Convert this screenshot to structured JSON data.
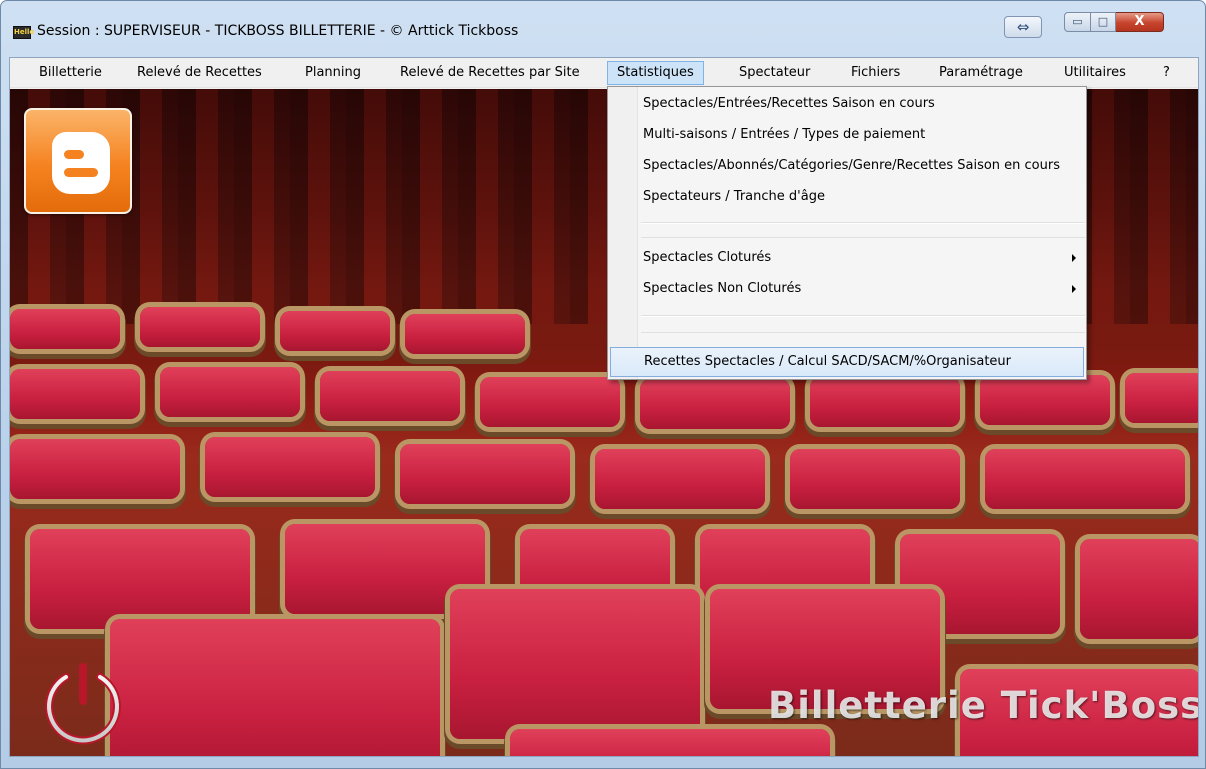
{
  "window": {
    "title": "Session : SUPERVISEUR - TICKBOSS BILLETTERIE -  © Arttick Tickboss",
    "app_icon_label": "Hello",
    "resize_glyph": "⇔",
    "minimize_glyph": "▭",
    "maximize_glyph": "□",
    "close_glyph": "X"
  },
  "menubar": {
    "items": [
      {
        "label": "Billetterie"
      },
      {
        "label": "Relevé de Recettes"
      },
      {
        "label": "Planning"
      },
      {
        "label": "Relevé de Recettes par Site"
      },
      {
        "label": "Statistiques",
        "active": true
      },
      {
        "label": "Spectateur"
      },
      {
        "label": "Fichiers"
      },
      {
        "label": "Paramétrage"
      },
      {
        "label": "Utilitaires"
      },
      {
        "label": "?"
      }
    ]
  },
  "dropdown": {
    "items": [
      {
        "label": "Spectacles/Entrées/Recettes Saison en cours"
      },
      {
        "label": "Multi-saisons / Entrées / Types de paiement"
      },
      {
        "label": "Spectacles/Abonnés/Catégories/Genre/Recettes Saison en cours"
      },
      {
        "label": "Spectateurs / Tranche d'âge"
      },
      {
        "label": "Spectacles Cloturés",
        "submenu": true
      },
      {
        "label": "Spectacles Non Cloturés",
        "submenu": true
      },
      {
        "label": "Recettes Spectacles / Calcul SACD/SACM/%Organisateur",
        "highlighted": true
      }
    ]
  },
  "background": {
    "brand_text": "Billetterie Tick'Boss",
    "logo_icon": "blogger-icon",
    "power_icon": "power-icon"
  },
  "colors": {
    "menu_active_bg": "#cde3f7",
    "menu_active_border": "#7eb4ea",
    "close_button": "#c7442c",
    "logo_orange": "#f58220",
    "seat_red": "#c92040"
  }
}
